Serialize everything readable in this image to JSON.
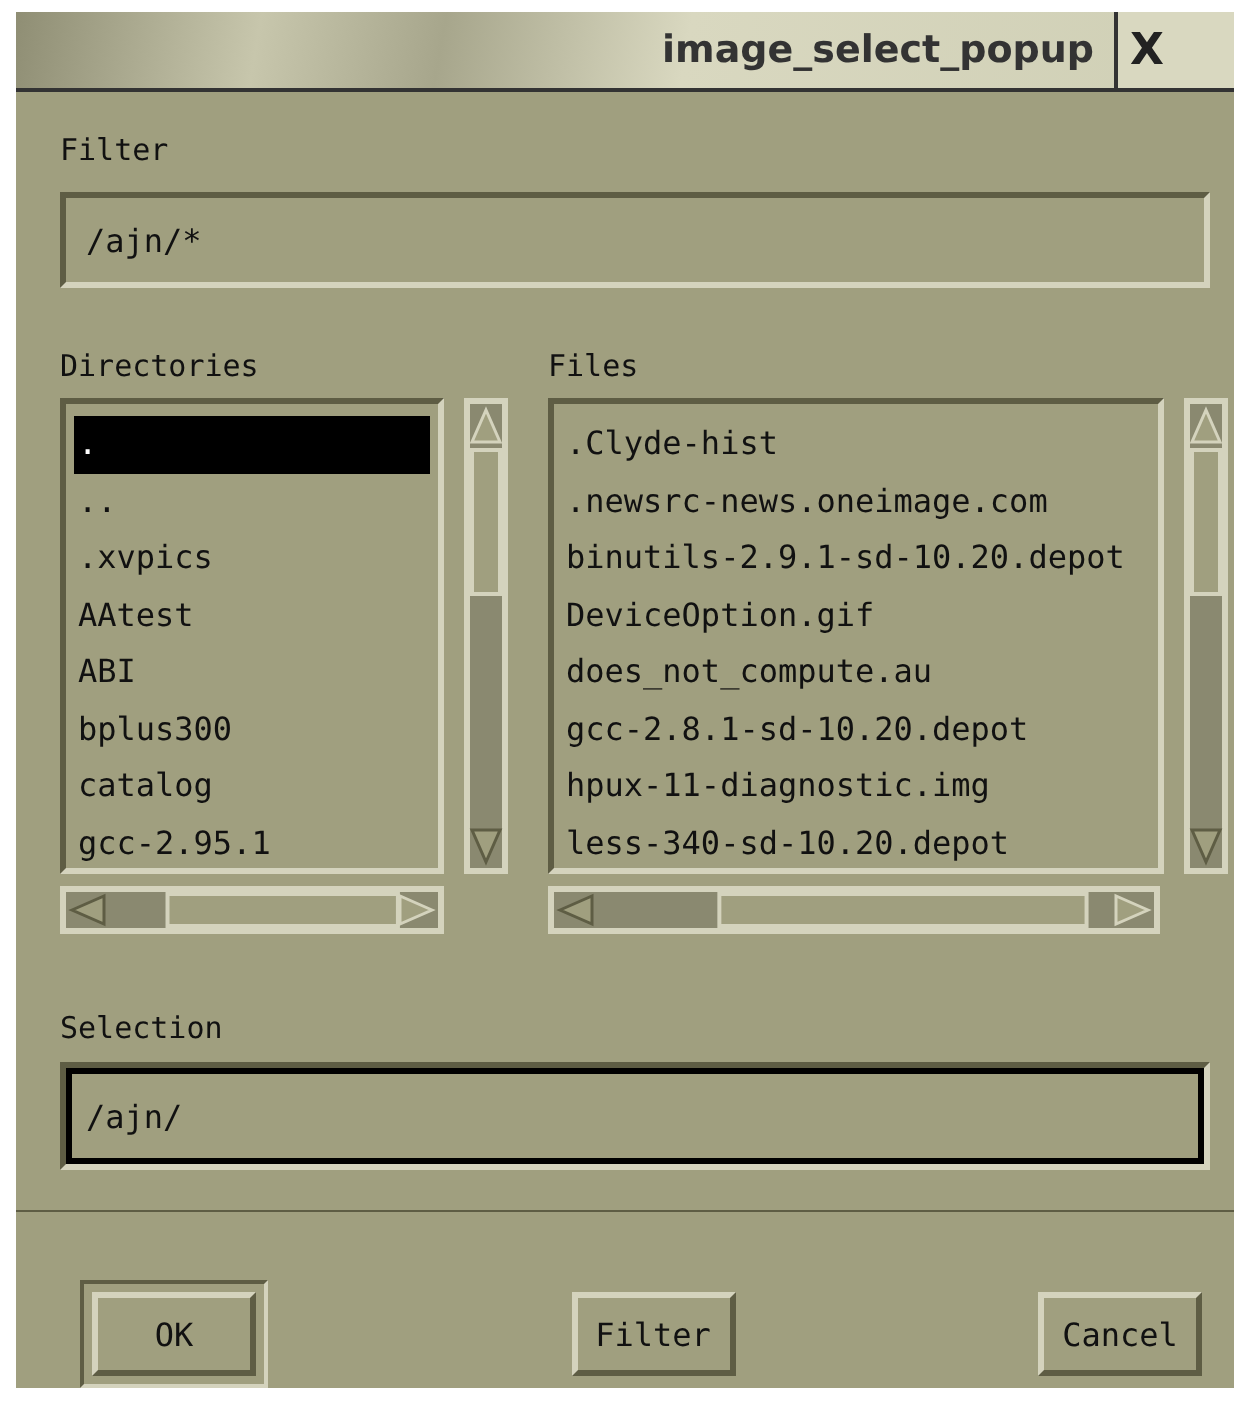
{
  "window": {
    "title": "image_select_popup",
    "close": "X"
  },
  "filter": {
    "label": "Filter",
    "value": "/ajn/*"
  },
  "directories": {
    "label": "Directories",
    "items": [
      {
        "name": ".",
        "selected": true
      },
      {
        "name": "..",
        "selected": false
      },
      {
        "name": ".xvpics",
        "selected": false
      },
      {
        "name": "AAtest",
        "selected": false
      },
      {
        "name": "ABI",
        "selected": false
      },
      {
        "name": "bplus300",
        "selected": false
      },
      {
        "name": "catalog",
        "selected": false
      },
      {
        "name": "gcc-2.95.1",
        "selected": false
      }
    ]
  },
  "files": {
    "label": "Files",
    "items": [
      {
        "name": ".Clyde-hist",
        "selected": false
      },
      {
        "name": ".newsrc-news.oneimage.com",
        "selected": false
      },
      {
        "name": "binutils-2.9.1-sd-10.20.depot",
        "selected": false
      },
      {
        "name": "DeviceOption.gif",
        "selected": false
      },
      {
        "name": "does_not_compute.au",
        "selected": false
      },
      {
        "name": "gcc-2.8.1-sd-10.20.depot",
        "selected": false
      },
      {
        "name": "hpux-11-diagnostic.img",
        "selected": false
      },
      {
        "name": "less-340-sd-10.20.depot",
        "selected": false
      }
    ]
  },
  "selection": {
    "label": "Selection",
    "value": "/ajn/"
  },
  "buttons": [
    {
      "label": "OK",
      "default": true
    },
    {
      "label": "Filter",
      "default": false
    },
    {
      "label": "Cancel",
      "default": false
    }
  ]
}
